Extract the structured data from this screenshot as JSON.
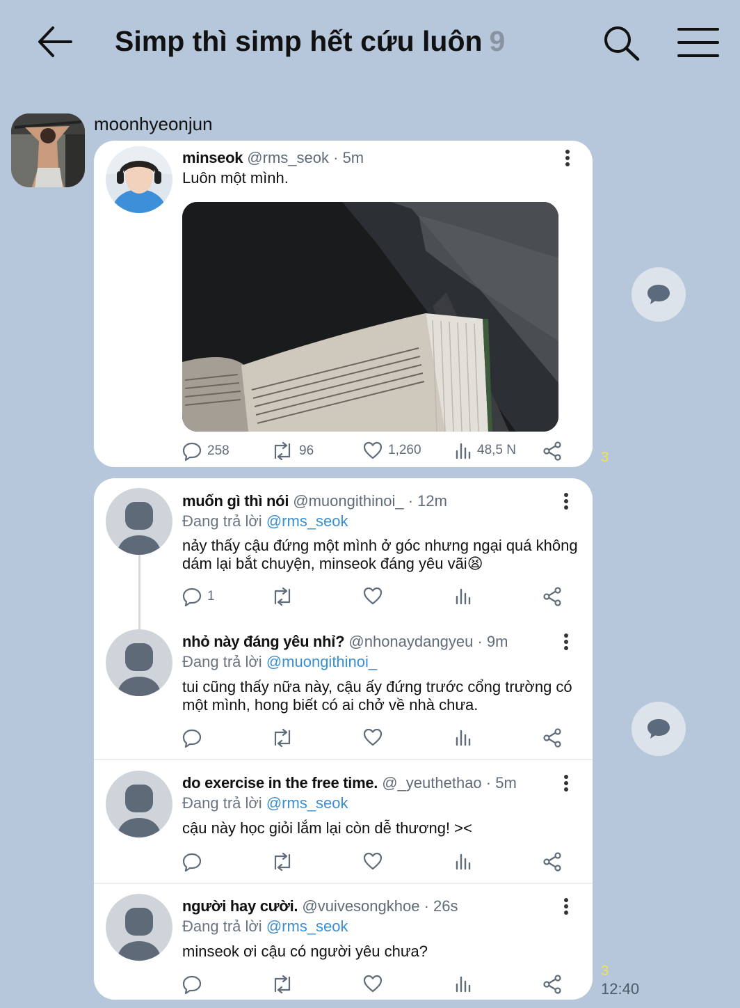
{
  "header": {
    "title": "Simp thì simp hết cứu luôn",
    "member_count": "9"
  },
  "sender": {
    "name": "moonhyeonjun"
  },
  "post": {
    "name": "minseok",
    "handle": "@rms_seok",
    "time": "· 5m",
    "text": "Luôn một mình.",
    "replies": "258",
    "retweets": "96",
    "likes": "1,260",
    "views": "48,5 N"
  },
  "replies": [
    {
      "name": "muốn gì thì nói",
      "handle": "@muongithinoi_",
      "time": "· 12m",
      "reply_prefix": "Đang trả lời",
      "reply_to": "@rms_seok",
      "text": "nảy thấy cậu đứng một mình ở góc nhưng ngại quá không dám lại bắt chuyện, minseok đáng yêu vãi😫",
      "reply_count": "1"
    },
    {
      "name": "nhỏ này đáng yêu nhỉ?",
      "handle": "@nhonaydangyeu",
      "time": "· 9m",
      "reply_prefix": "Đang trả lời",
      "reply_to": "@muongithinoi_",
      "text": "tui cũng thấy nữa này, cậu ấy đứng trước cổng trường có một mình, hong biết có ai chở về nhà chưa."
    },
    {
      "name": "do exercise in the free time.",
      "handle": "@_yeuthethao",
      "time": "· 5m",
      "reply_prefix": "Đang trả lời",
      "reply_to": "@rms_seok",
      "text": "cậu này học giỏi lắm lại còn dễ thương! ><"
    },
    {
      "name": "người hay cười.",
      "handle": "@vuivesongkhoe",
      "time": "· 26s",
      "reply_prefix": "Đang trả lời",
      "reply_to": "@rms_seok",
      "text": "minseok ơi cậu có người yêu chưa?"
    }
  ],
  "read_count_1": "3",
  "read_count_2": "3",
  "time": "12:40",
  "colors": {
    "background": "#b6c7db",
    "link": "#3a8fd0",
    "unread": "#f4e44a"
  }
}
